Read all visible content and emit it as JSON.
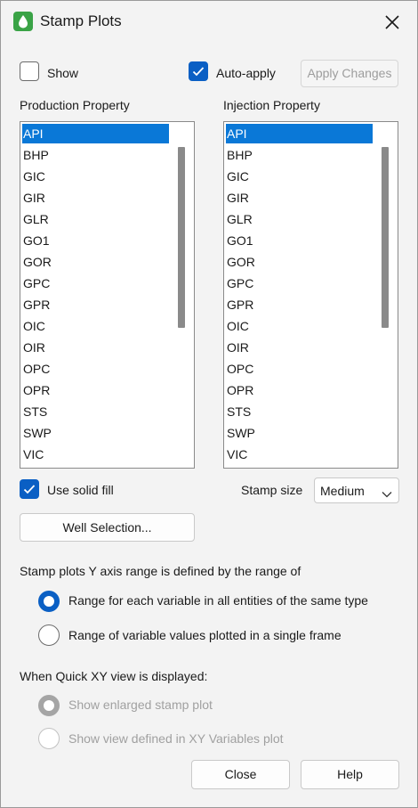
{
  "window": {
    "title": "Stamp Plots"
  },
  "options": {
    "show_label": "Show",
    "show_checked": false,
    "auto_apply_label": "Auto-apply",
    "auto_apply_checked": true,
    "apply_changes_label": "Apply Changes"
  },
  "production": {
    "label": "Production Property",
    "items": [
      "API",
      "BHP",
      "GIC",
      "GIR",
      "GLR",
      "GO1",
      "GOR",
      "GPC",
      "GPR",
      "OIC",
      "OIR",
      "OPC",
      "OPR",
      "STS",
      "SWP",
      "VIC"
    ],
    "selected": "API"
  },
  "injection": {
    "label": "Injection Property",
    "items": [
      "API",
      "BHP",
      "GIC",
      "GIR",
      "GLR",
      "GO1",
      "GOR",
      "GPC",
      "GPR",
      "OIC",
      "OIR",
      "OPC",
      "OPR",
      "STS",
      "SWP",
      "VIC"
    ],
    "selected": "API"
  },
  "solid_fill": {
    "label": "Use solid fill",
    "checked": true
  },
  "stamp_size": {
    "label": "Stamp size",
    "value": "Medium"
  },
  "well_selection_label": "Well Selection...",
  "y_axis": {
    "heading": "Stamp plots Y axis range is defined by the range of",
    "option1": "Range for each variable in all entities of the same type",
    "option2": "Range of variable values plotted in a single frame",
    "selected": 1
  },
  "quick_xy": {
    "heading": "When Quick XY view is displayed:",
    "option1": "Show enlarged stamp plot",
    "option2": "Show view defined in XY Variables plot",
    "selected": 1,
    "enabled": false
  },
  "footer": {
    "close_label": "Close",
    "help_label": "Help"
  },
  "colors": {
    "accent": "#0a5fc4",
    "selection": "#0a78d7",
    "icon": "#3aa346"
  }
}
